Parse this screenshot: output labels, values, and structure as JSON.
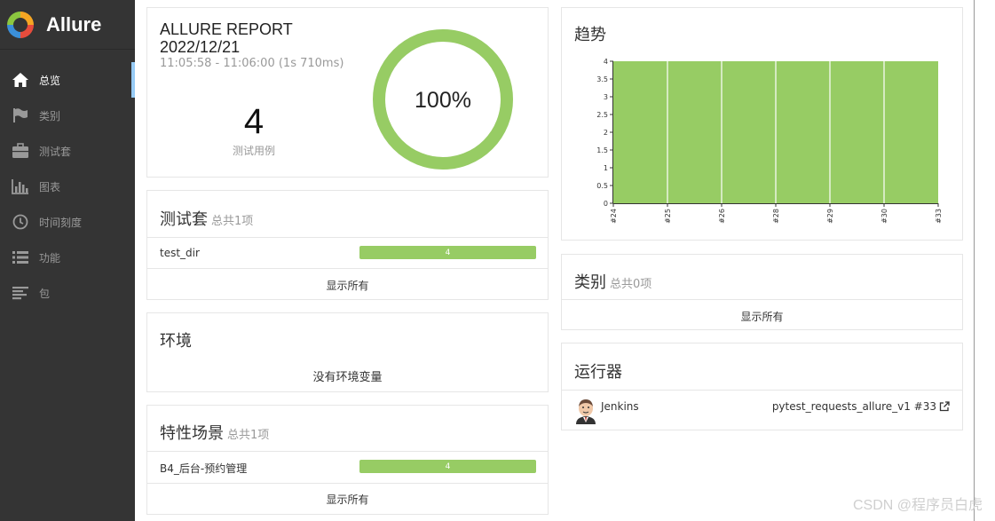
{
  "brand": {
    "name": "Allure"
  },
  "sidebar": {
    "items": [
      {
        "label": "总览",
        "icon": "home-icon"
      },
      {
        "label": "类别",
        "icon": "flag-icon"
      },
      {
        "label": "测试套",
        "icon": "briefcase-icon"
      },
      {
        "label": "图表",
        "icon": "bar-chart-icon"
      },
      {
        "label": "时间刻度",
        "icon": "clock-icon"
      },
      {
        "label": "功能",
        "icon": "list-icon"
      },
      {
        "label": "包",
        "icon": "align-left-icon"
      }
    ]
  },
  "summary": {
    "title": "ALLURE REPORT",
    "date": "2022/12/21",
    "time": "11:05:58 - 11:06:00 (1s 710ms)",
    "count": "4",
    "count_label": "测试用例",
    "percent": "100%",
    "pass_fraction": 1.0
  },
  "suites": {
    "title": "测试套",
    "subtitle": "总共1项",
    "rows": [
      {
        "name": "test_dir",
        "value": "4"
      }
    ],
    "show_all": "显示所有"
  },
  "environment": {
    "title": "环境",
    "empty": "没有环境变量"
  },
  "features": {
    "title": "特性场景",
    "subtitle": "总共1项",
    "rows": [
      {
        "name": "B4_后台-预约管理",
        "value": "4"
      }
    ],
    "show_all": "显示所有"
  },
  "trend": {
    "title": "趋势"
  },
  "categories": {
    "title": "类别",
    "subtitle": "总共0项",
    "show_all": "显示所有"
  },
  "executors": {
    "title": "运行器",
    "name": "Jenkins",
    "build": "pytest_requests_allure_v1 #33"
  },
  "watermark": "CSDN @程序员白虎",
  "colors": {
    "passed": "#97cc64",
    "sidebar": "#343434",
    "accent": "#97cbf5"
  },
  "chart_data": {
    "type": "area",
    "x": [
      "#24",
      "#25",
      "#26",
      "#28",
      "#29",
      "#30",
      "#33"
    ],
    "series": [
      {
        "values": [
          4,
          4,
          4,
          4,
          4,
          4,
          4
        ]
      }
    ],
    "ylim": [
      0,
      4
    ],
    "yticks": [
      "0",
      "0.5",
      "1",
      "1.5",
      "2",
      "2.5",
      "3",
      "3.5",
      "4"
    ],
    "grid": true
  }
}
